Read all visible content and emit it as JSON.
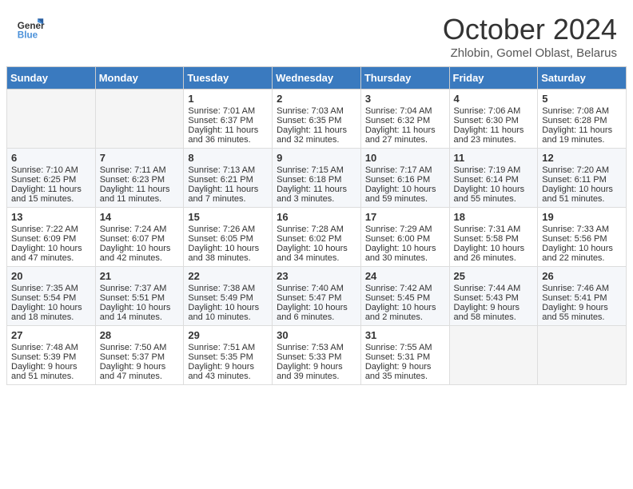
{
  "header": {
    "logo_line1": "General",
    "logo_line2": "Blue",
    "month": "October 2024",
    "location": "Zhlobin, Gomel Oblast, Belarus"
  },
  "days_of_week": [
    "Sunday",
    "Monday",
    "Tuesday",
    "Wednesday",
    "Thursday",
    "Friday",
    "Saturday"
  ],
  "weeks": [
    [
      {
        "day": "",
        "sunrise": "",
        "sunset": "",
        "daylight": ""
      },
      {
        "day": "",
        "sunrise": "",
        "sunset": "",
        "daylight": ""
      },
      {
        "day": "1",
        "sunrise": "Sunrise: 7:01 AM",
        "sunset": "Sunset: 6:37 PM",
        "daylight": "Daylight: 11 hours and 36 minutes."
      },
      {
        "day": "2",
        "sunrise": "Sunrise: 7:03 AM",
        "sunset": "Sunset: 6:35 PM",
        "daylight": "Daylight: 11 hours and 32 minutes."
      },
      {
        "day": "3",
        "sunrise": "Sunrise: 7:04 AM",
        "sunset": "Sunset: 6:32 PM",
        "daylight": "Daylight: 11 hours and 27 minutes."
      },
      {
        "day": "4",
        "sunrise": "Sunrise: 7:06 AM",
        "sunset": "Sunset: 6:30 PM",
        "daylight": "Daylight: 11 hours and 23 minutes."
      },
      {
        "day": "5",
        "sunrise": "Sunrise: 7:08 AM",
        "sunset": "Sunset: 6:28 PM",
        "daylight": "Daylight: 11 hours and 19 minutes."
      }
    ],
    [
      {
        "day": "6",
        "sunrise": "Sunrise: 7:10 AM",
        "sunset": "Sunset: 6:25 PM",
        "daylight": "Daylight: 11 hours and 15 minutes."
      },
      {
        "day": "7",
        "sunrise": "Sunrise: 7:11 AM",
        "sunset": "Sunset: 6:23 PM",
        "daylight": "Daylight: 11 hours and 11 minutes."
      },
      {
        "day": "8",
        "sunrise": "Sunrise: 7:13 AM",
        "sunset": "Sunset: 6:21 PM",
        "daylight": "Daylight: 11 hours and 7 minutes."
      },
      {
        "day": "9",
        "sunrise": "Sunrise: 7:15 AM",
        "sunset": "Sunset: 6:18 PM",
        "daylight": "Daylight: 11 hours and 3 minutes."
      },
      {
        "day": "10",
        "sunrise": "Sunrise: 7:17 AM",
        "sunset": "Sunset: 6:16 PM",
        "daylight": "Daylight: 10 hours and 59 minutes."
      },
      {
        "day": "11",
        "sunrise": "Sunrise: 7:19 AM",
        "sunset": "Sunset: 6:14 PM",
        "daylight": "Daylight: 10 hours and 55 minutes."
      },
      {
        "day": "12",
        "sunrise": "Sunrise: 7:20 AM",
        "sunset": "Sunset: 6:11 PM",
        "daylight": "Daylight: 10 hours and 51 minutes."
      }
    ],
    [
      {
        "day": "13",
        "sunrise": "Sunrise: 7:22 AM",
        "sunset": "Sunset: 6:09 PM",
        "daylight": "Daylight: 10 hours and 47 minutes."
      },
      {
        "day": "14",
        "sunrise": "Sunrise: 7:24 AM",
        "sunset": "Sunset: 6:07 PM",
        "daylight": "Daylight: 10 hours and 42 minutes."
      },
      {
        "day": "15",
        "sunrise": "Sunrise: 7:26 AM",
        "sunset": "Sunset: 6:05 PM",
        "daylight": "Daylight: 10 hours and 38 minutes."
      },
      {
        "day": "16",
        "sunrise": "Sunrise: 7:28 AM",
        "sunset": "Sunset: 6:02 PM",
        "daylight": "Daylight: 10 hours and 34 minutes."
      },
      {
        "day": "17",
        "sunrise": "Sunrise: 7:29 AM",
        "sunset": "Sunset: 6:00 PM",
        "daylight": "Daylight: 10 hours and 30 minutes."
      },
      {
        "day": "18",
        "sunrise": "Sunrise: 7:31 AM",
        "sunset": "Sunset: 5:58 PM",
        "daylight": "Daylight: 10 hours and 26 minutes."
      },
      {
        "day": "19",
        "sunrise": "Sunrise: 7:33 AM",
        "sunset": "Sunset: 5:56 PM",
        "daylight": "Daylight: 10 hours and 22 minutes."
      }
    ],
    [
      {
        "day": "20",
        "sunrise": "Sunrise: 7:35 AM",
        "sunset": "Sunset: 5:54 PM",
        "daylight": "Daylight: 10 hours and 18 minutes."
      },
      {
        "day": "21",
        "sunrise": "Sunrise: 7:37 AM",
        "sunset": "Sunset: 5:51 PM",
        "daylight": "Daylight: 10 hours and 14 minutes."
      },
      {
        "day": "22",
        "sunrise": "Sunrise: 7:38 AM",
        "sunset": "Sunset: 5:49 PM",
        "daylight": "Daylight: 10 hours and 10 minutes."
      },
      {
        "day": "23",
        "sunrise": "Sunrise: 7:40 AM",
        "sunset": "Sunset: 5:47 PM",
        "daylight": "Daylight: 10 hours and 6 minutes."
      },
      {
        "day": "24",
        "sunrise": "Sunrise: 7:42 AM",
        "sunset": "Sunset: 5:45 PM",
        "daylight": "Daylight: 10 hours and 2 minutes."
      },
      {
        "day": "25",
        "sunrise": "Sunrise: 7:44 AM",
        "sunset": "Sunset: 5:43 PM",
        "daylight": "Daylight: 9 hours and 58 minutes."
      },
      {
        "day": "26",
        "sunrise": "Sunrise: 7:46 AM",
        "sunset": "Sunset: 5:41 PM",
        "daylight": "Daylight: 9 hours and 55 minutes."
      }
    ],
    [
      {
        "day": "27",
        "sunrise": "Sunrise: 7:48 AM",
        "sunset": "Sunset: 5:39 PM",
        "daylight": "Daylight: 9 hours and 51 minutes."
      },
      {
        "day": "28",
        "sunrise": "Sunrise: 7:50 AM",
        "sunset": "Sunset: 5:37 PM",
        "daylight": "Daylight: 9 hours and 47 minutes."
      },
      {
        "day": "29",
        "sunrise": "Sunrise: 7:51 AM",
        "sunset": "Sunset: 5:35 PM",
        "daylight": "Daylight: 9 hours and 43 minutes."
      },
      {
        "day": "30",
        "sunrise": "Sunrise: 7:53 AM",
        "sunset": "Sunset: 5:33 PM",
        "daylight": "Daylight: 9 hours and 39 minutes."
      },
      {
        "day": "31",
        "sunrise": "Sunrise: 7:55 AM",
        "sunset": "Sunset: 5:31 PM",
        "daylight": "Daylight: 9 hours and 35 minutes."
      },
      {
        "day": "",
        "sunrise": "",
        "sunset": "",
        "daylight": ""
      },
      {
        "day": "",
        "sunrise": "",
        "sunset": "",
        "daylight": ""
      }
    ]
  ]
}
